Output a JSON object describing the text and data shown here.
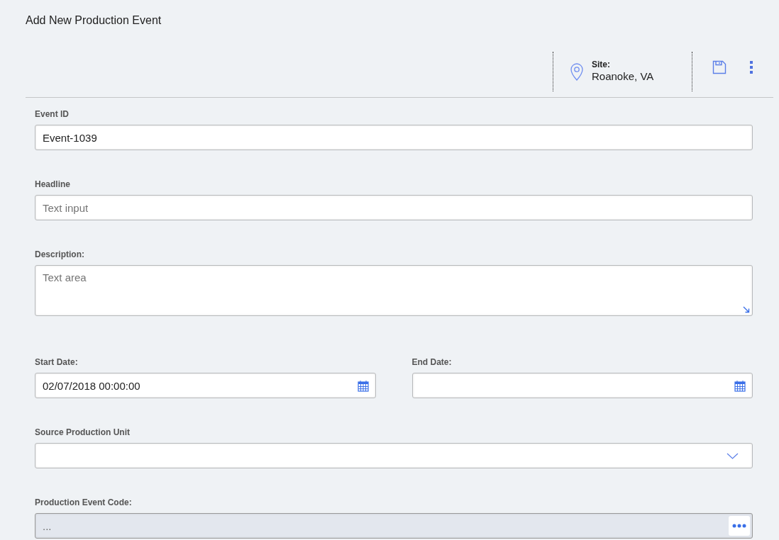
{
  "title": "Add New Production Event",
  "site": {
    "label": "Site:",
    "value": "Roanoke, VA"
  },
  "fields": [
    {
      "kind": "text",
      "label": "Event ID",
      "value": "Event-1039"
    },
    {
      "kind": "text",
      "label": "Headline",
      "placeholder": "Text input"
    },
    {
      "kind": "textarea",
      "label": "Description:",
      "placeholder": "Text area"
    },
    {
      "kind": "dates",
      "items": [
        {
          "label": "Start Date:",
          "value": "02/07/2018 00:00:00"
        },
        {
          "label": "End Date:"
        }
      ]
    },
    {
      "kind": "select",
      "label": "Source Production Unit"
    },
    {
      "kind": "lookup",
      "label": "Production Event Code:",
      "placeholder": "...",
      "disabled": true
    }
  ]
}
